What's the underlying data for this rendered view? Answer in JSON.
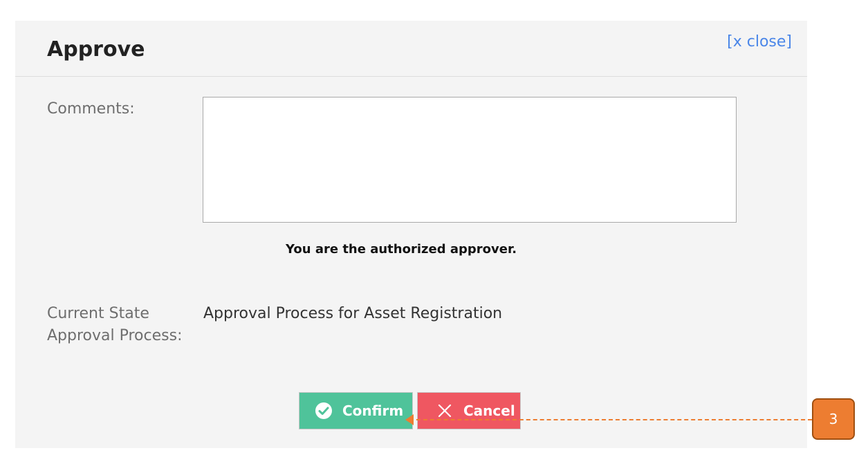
{
  "dialog": {
    "title": "Approve",
    "close_label": "[x close]"
  },
  "form": {
    "comments_label": "Comments:",
    "comments_value": "",
    "approver_note": "You are the authorized approver.",
    "state_label": "Current State Approval Process:",
    "state_value": "Approval Process for Asset Registration"
  },
  "actions": {
    "confirm_label": "Confirm",
    "confirm_icon": "check-circle-icon",
    "cancel_label": "Cancel",
    "cancel_icon": "close-x-icon"
  },
  "annotation": {
    "step_number": "3",
    "color": "#ed7d31"
  },
  "colors": {
    "confirm_bg": "#4fc39a",
    "cancel_bg": "#ef5761",
    "link": "#4a86e8"
  }
}
